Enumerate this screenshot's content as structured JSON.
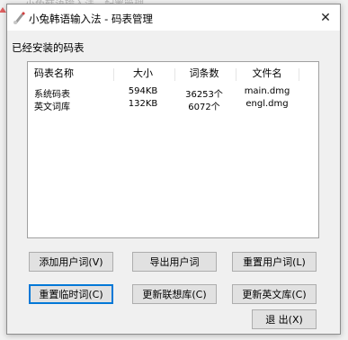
{
  "background_window": {
    "title": "小兔韩语输入法 - 配置管理"
  },
  "dialog": {
    "title": "小兔韩语输入法 - 码表管理",
    "close_glyph": "✕",
    "section_label": "已经安装的码表",
    "table": {
      "headers": [
        "码表名称",
        "大小",
        "词条数",
        "文件名"
      ],
      "rows": [
        [
          "系统码表",
          "594KB",
          "36253个",
          "main.dmg"
        ],
        [
          "英文词库",
          "132KB",
          "6072个",
          "engl.dmg"
        ]
      ]
    },
    "buttons": {
      "add_user_words": "添加用户词(V)",
      "export_user_words": "导出用户词",
      "reset_user_words": "重置用户词(L)",
      "reset_temp_words": "重置临时词(C)",
      "update_assoc_lib": "更新联想库(C)",
      "update_english_lib": "更新英文库(C)",
      "exit": "退 出(X)"
    }
  },
  "colors": {
    "default_button_border": "#0078d7",
    "dialog_bg": "#f0f0f0"
  }
}
